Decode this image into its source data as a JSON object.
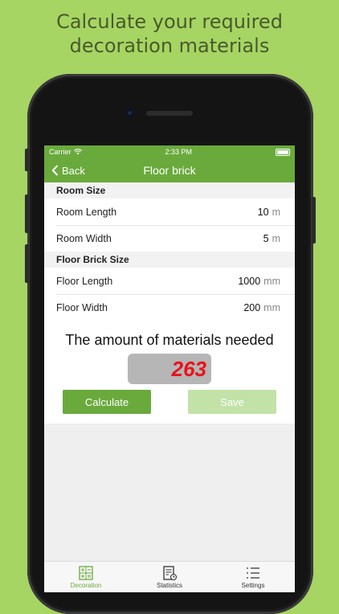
{
  "promo": {
    "line1": "Calculate your required",
    "line2": "decoration materials"
  },
  "status": {
    "carrier": "Carrier",
    "time": "2:33 PM"
  },
  "nav": {
    "back_label": "Back",
    "title": "Floor brick"
  },
  "room_size": {
    "header": "Room Size",
    "rows": [
      {
        "label": "Room Length",
        "value": "10",
        "unit": "m"
      },
      {
        "label": "Room Width",
        "value": "5",
        "unit": "m"
      }
    ]
  },
  "brick_size": {
    "header": "Floor Brick Size",
    "rows": [
      {
        "label": "Floor Length",
        "value": "1000",
        "unit": "mm"
      },
      {
        "label": "Floor Width",
        "value": "200",
        "unit": "mm"
      }
    ]
  },
  "result": {
    "title": "The amount of materials needed",
    "value": "263",
    "value_color": "#e8131a"
  },
  "buttons": {
    "calculate": "Calculate",
    "save": "Save"
  },
  "tabs": [
    {
      "label": "Decoration",
      "icon": "calculator-icon",
      "active": true
    },
    {
      "label": "Statistics",
      "icon": "statistics-icon",
      "active": false
    },
    {
      "label": "Settings",
      "icon": "settings-list-icon",
      "active": false
    }
  ],
  "colors": {
    "background": "#a6d563",
    "accent": "#6aaa3c",
    "save_disabled": "#c2e2a8"
  }
}
